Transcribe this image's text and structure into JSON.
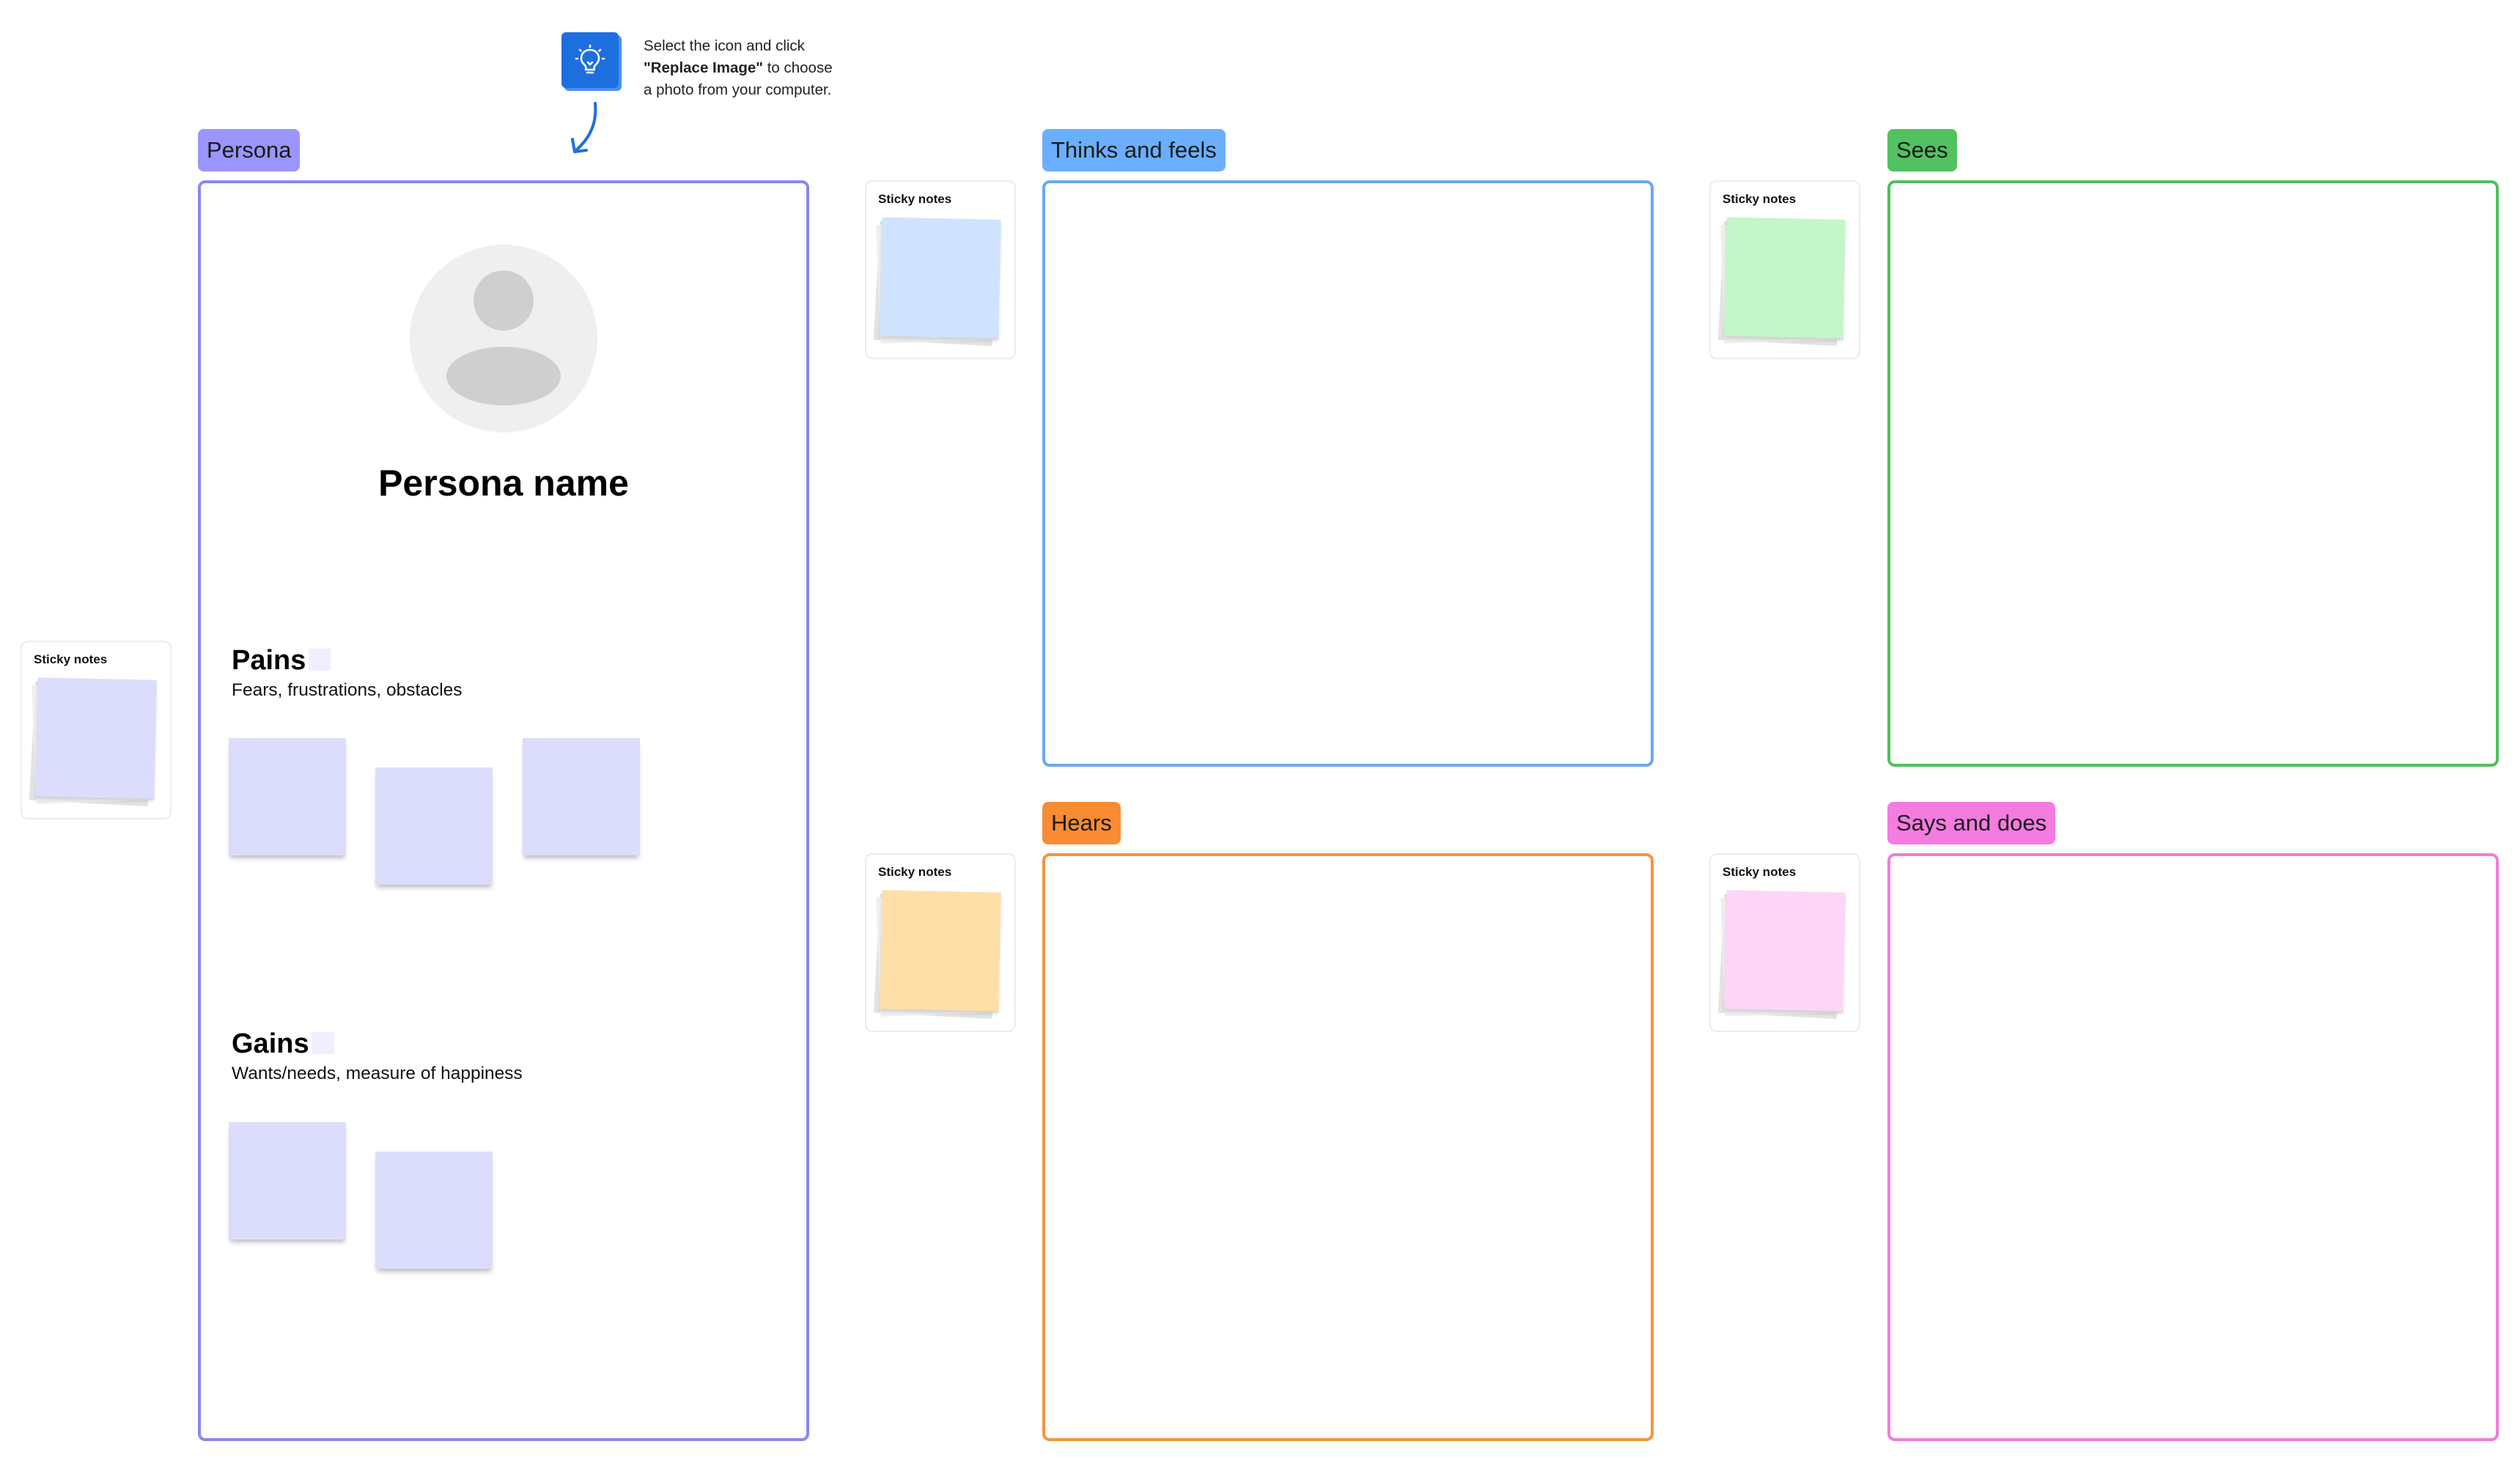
{
  "hint": {
    "line1": "Select the icon and click",
    "line2_bold": "\"Replace Image\"",
    "line2_rest": " to choose",
    "line3": "a photo from your computer."
  },
  "sections": {
    "persona": "Persona",
    "thinks": "Thinks and feels",
    "sees": "Sees",
    "hears": "Hears",
    "says": "Says and does"
  },
  "colors": {
    "persona": "#9b95ff",
    "persona_border": "#8a86f2",
    "thinks": "#6aafff",
    "thinks_border": "#6aa8f5",
    "sees": "#52c160",
    "sees_border": "#4dc05a",
    "hears": "#f98c32",
    "hears_border": "#f5953c",
    "says": "#f47be0",
    "says_border": "#f07dd8",
    "note_purple": "#dcdcfc",
    "note_blue": "#cfe3ff",
    "note_green": "#c3f6c9",
    "note_orange": "#fedfa7",
    "note_pink": "#fdd5f6"
  },
  "sticky_label": "Sticky notes",
  "persona_card": {
    "name": "Persona name",
    "pains_title": "Pains",
    "pains_sub": "Fears, frustrations, obstacles",
    "gains_title": "Gains",
    "gains_sub": "Wants/needs, measure of happiness"
  }
}
